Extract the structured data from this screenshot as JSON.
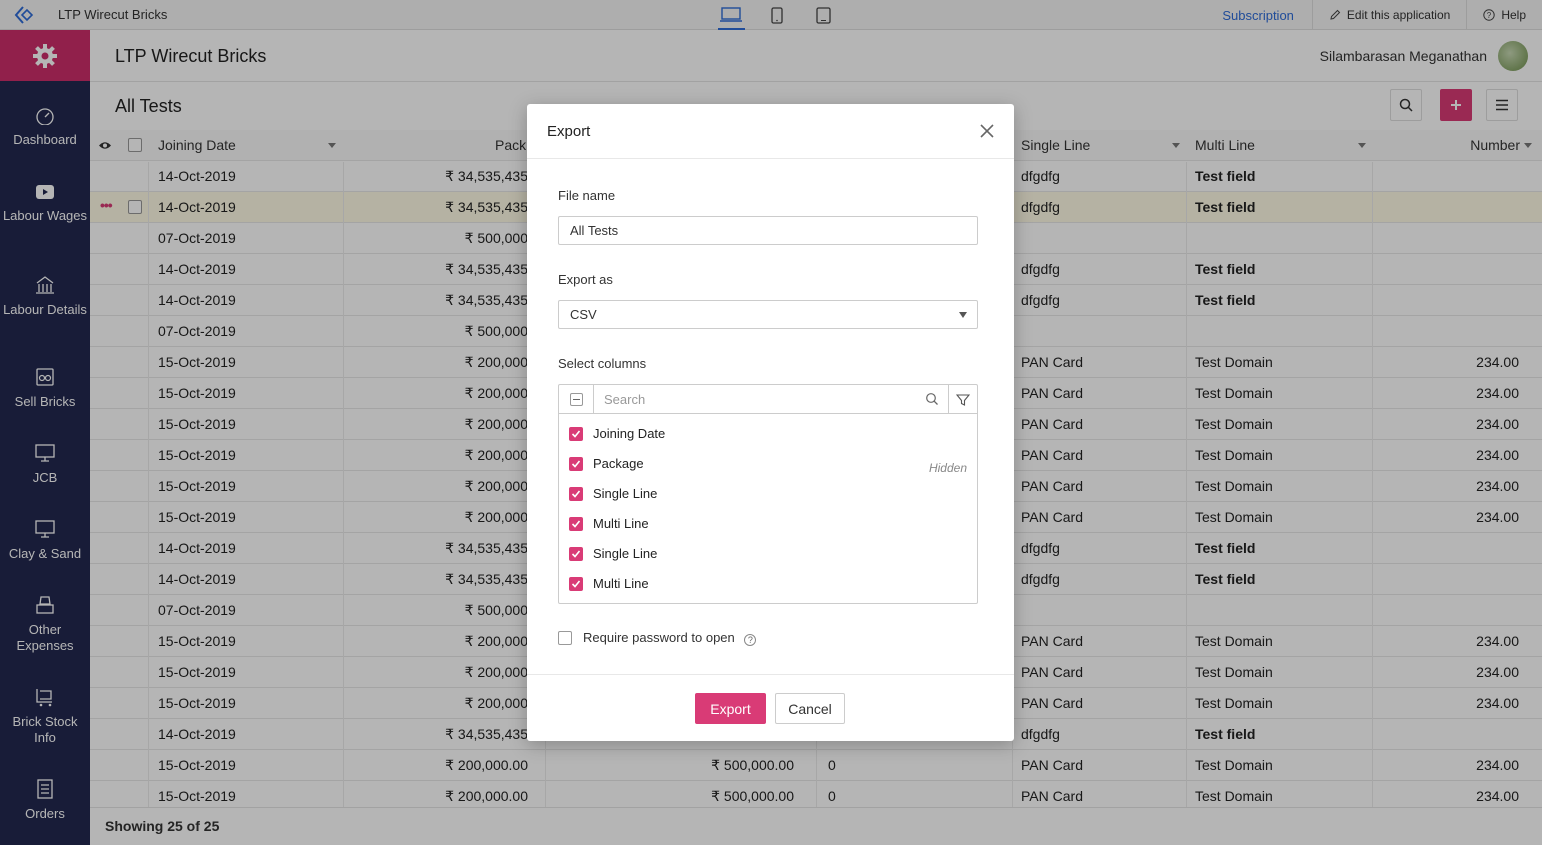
{
  "topbar": {
    "app_title": "LTP Wirecut Bricks",
    "subscription": "Subscription",
    "edit_app": "Edit this application",
    "help": "Help"
  },
  "header": {
    "title": "LTP Wirecut Bricks",
    "user_name": "Silambarasan Meganathan"
  },
  "sidebar": {
    "items": [
      {
        "label": "Dashboard",
        "icon": "dashboard-icon"
      },
      {
        "label": "Labour Wages",
        "icon": "video-icon"
      },
      {
        "label": "Labour Details",
        "icon": "building-icon"
      },
      {
        "label": "Sell Bricks",
        "icon": "bricks-icon"
      },
      {
        "label": "JCB",
        "icon": "monitor-icon"
      },
      {
        "label": "Clay & Sand",
        "icon": "monitor-icon"
      },
      {
        "label": "Other Expenses",
        "icon": "register-icon"
      },
      {
        "label": "Brick Stock Info",
        "icon": "cart-icon"
      },
      {
        "label": "Orders",
        "icon": "list-icon"
      }
    ]
  },
  "report": {
    "title": "All Tests",
    "columns": {
      "joining_date": "Joining Date",
      "package": "Pack",
      "single_line": "Single Line",
      "multi_line": "Multi Line",
      "number": "Number"
    },
    "rows": [
      {
        "date": "14-Oct-2019",
        "pkg": "₹ 34,535,435",
        "amt": "",
        "zero": "",
        "single": "dfgdfg",
        "multi": "Test field",
        "num": ""
      },
      {
        "date": "14-Oct-2019",
        "pkg": "₹ 34,535,435",
        "amt": "",
        "zero": "",
        "single": "dfgdfg",
        "multi": "Test field",
        "num": ""
      },
      {
        "date": "07-Oct-2019",
        "pkg": "₹ 500,000",
        "amt": "",
        "zero": "",
        "single": "",
        "multi": "",
        "num": ""
      },
      {
        "date": "14-Oct-2019",
        "pkg": "₹ 34,535,435",
        "amt": "",
        "zero": "",
        "single": "dfgdfg",
        "multi": "Test field",
        "num": ""
      },
      {
        "date": "14-Oct-2019",
        "pkg": "₹ 34,535,435",
        "amt": "",
        "zero": "",
        "single": "dfgdfg",
        "multi": "Test field",
        "num": ""
      },
      {
        "date": "07-Oct-2019",
        "pkg": "₹ 500,000",
        "amt": "",
        "zero": "",
        "single": "",
        "multi": "",
        "num": ""
      },
      {
        "date": "15-Oct-2019",
        "pkg": "₹ 200,000",
        "amt": "",
        "zero": "",
        "single": "PAN Card",
        "multi": "Test Domain",
        "num": "234.00"
      },
      {
        "date": "15-Oct-2019",
        "pkg": "₹ 200,000",
        "amt": "",
        "zero": "",
        "single": "PAN Card",
        "multi": "Test Domain",
        "num": "234.00"
      },
      {
        "date": "15-Oct-2019",
        "pkg": "₹ 200,000",
        "amt": "",
        "zero": "",
        "single": "PAN Card",
        "multi": "Test Domain",
        "num": "234.00"
      },
      {
        "date": "15-Oct-2019",
        "pkg": "₹ 200,000",
        "amt": "",
        "zero": "",
        "single": "PAN Card",
        "multi": "Test Domain",
        "num": "234.00"
      },
      {
        "date": "15-Oct-2019",
        "pkg": "₹ 200,000",
        "amt": "",
        "zero": "",
        "single": "PAN Card",
        "multi": "Test Domain",
        "num": "234.00"
      },
      {
        "date": "15-Oct-2019",
        "pkg": "₹ 200,000",
        "amt": "",
        "zero": "",
        "single": "PAN Card",
        "multi": "Test Domain",
        "num": "234.00"
      },
      {
        "date": "14-Oct-2019",
        "pkg": "₹ 34,535,435",
        "amt": "",
        "zero": "",
        "single": "dfgdfg",
        "multi": "Test field",
        "num": ""
      },
      {
        "date": "14-Oct-2019",
        "pkg": "₹ 34,535,435",
        "amt": "",
        "zero": "",
        "single": "dfgdfg",
        "multi": "Test field",
        "num": ""
      },
      {
        "date": "07-Oct-2019",
        "pkg": "₹ 500,000",
        "amt": "",
        "zero": "",
        "single": "",
        "multi": "",
        "num": ""
      },
      {
        "date": "15-Oct-2019",
        "pkg": "₹ 200,000",
        "amt": "",
        "zero": "",
        "single": "PAN Card",
        "multi": "Test Domain",
        "num": "234.00"
      },
      {
        "date": "15-Oct-2019",
        "pkg": "₹ 200,000",
        "amt": "",
        "zero": "",
        "single": "PAN Card",
        "multi": "Test Domain",
        "num": "234.00"
      },
      {
        "date": "15-Oct-2019",
        "pkg": "₹ 200,000",
        "amt": "",
        "zero": "",
        "single": "PAN Card",
        "multi": "Test Domain",
        "num": "234.00"
      },
      {
        "date": "14-Oct-2019",
        "pkg": "₹ 34,535,435",
        "amt": "",
        "zero": "",
        "single": "dfgdfg",
        "multi": "Test field",
        "num": ""
      },
      {
        "date": "15-Oct-2019",
        "pkg": "₹ 200,000.00",
        "amt": "₹ 500,000.00",
        "zero": "0",
        "single": "PAN Card",
        "multi": "Test Domain",
        "num": "234.00"
      },
      {
        "date": "15-Oct-2019",
        "pkg": "₹ 200,000.00",
        "amt": "₹ 500,000.00",
        "zero": "0",
        "single": "PAN Card",
        "multi": "Test Domain",
        "num": "234.00"
      }
    ],
    "footer": "Showing 25 of 25"
  },
  "modal": {
    "title": "Export",
    "file_name_label": "File name",
    "file_name_value": "All Tests",
    "export_as_label": "Export as",
    "export_as_value": "CSV",
    "select_columns_label": "Select columns",
    "search_placeholder": "Search",
    "hidden_tag": "Hidden",
    "columns": [
      "Joining Date",
      "Package",
      "Single Line",
      "Multi Line",
      "Single Line",
      "Multi Line"
    ],
    "password_label": "Require password to open",
    "export_button": "Export",
    "cancel_button": "Cancel"
  },
  "colors": {
    "accent": "#d93b76",
    "sidebar": "#222850",
    "link": "#2e6bd8"
  }
}
